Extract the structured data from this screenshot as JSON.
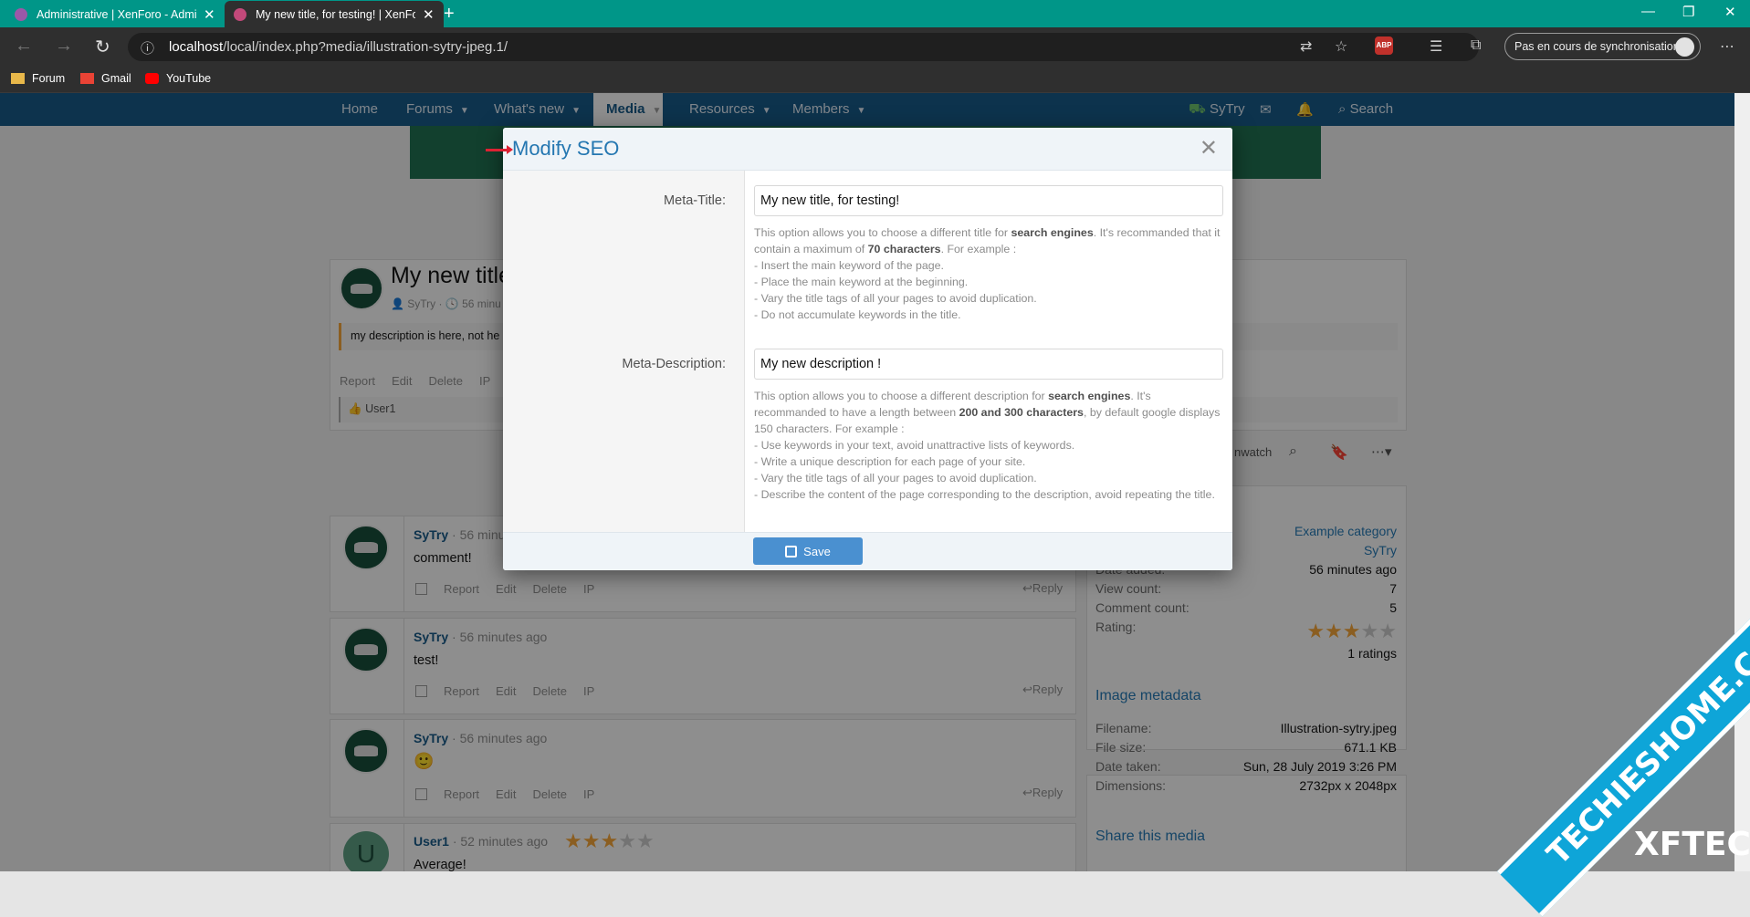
{
  "browser": {
    "tabs": [
      {
        "title": "Administrative | XenForo - Admin",
        "active": false
      },
      {
        "title": "My new title, for testing! | XenForo",
        "active": true
      }
    ],
    "url_host": "localhost",
    "url_path": "/local/index.php?media/illustration-sytry-jpeg.1/",
    "sync_label": "Pas en cours de synchronisation",
    "bookmarks": [
      "Forum",
      "Gmail",
      "YouTube"
    ]
  },
  "nav": {
    "items": [
      "Home",
      "Forums",
      "What's new",
      "Media",
      "Resources",
      "Members"
    ],
    "user": "SyTry",
    "search": "Search"
  },
  "media": {
    "title": "My new title",
    "author": "SyTry",
    "time": "56 minu",
    "description": "my description is here, not he",
    "actions": [
      "Report",
      "Edit",
      "Delete",
      "IP"
    ],
    "liker": "User1",
    "unwatch": "nwatch"
  },
  "comments": [
    {
      "user": "SyTry",
      "time": "· 56 minu",
      "text": "comment!"
    },
    {
      "user": "SyTry",
      "time": "· 56 minutes ago",
      "text": "test!"
    },
    {
      "user": "SyTry",
      "time": "· 56 minutes ago",
      "text": "🙂"
    },
    {
      "user": "User1",
      "time": "· 52 minutes ago",
      "text": "Average!"
    }
  ],
  "comment_actions": [
    "Report",
    "Edit",
    "Delete",
    "IP"
  ],
  "reply_label": "Reply",
  "sidebar": {
    "category": "Example category",
    "owner": "SyTry",
    "date_label": "Date added:",
    "date_value": "56 minutes ago",
    "view_label": "View count:",
    "view_value": "7",
    "comment_label": "Comment count:",
    "comment_value": "5",
    "rating_label": "Rating:",
    "rating_value": 3,
    "ratings_text": "1 ratings",
    "metadata_title": "Image metadata",
    "metadata": [
      {
        "k": "Filename:",
        "v": "Illustration-sytry.jpeg"
      },
      {
        "k": "File size:",
        "v": "671.1 KB"
      },
      {
        "k": "Date taken:",
        "v": "Sun, 28 July 2019 3:26 PM"
      },
      {
        "k": "Dimensions:",
        "v": "2732px x 2048px"
      }
    ],
    "share_title": "Share this media"
  },
  "modal": {
    "title": "Modify SEO",
    "meta_title_label": "Meta-Title:",
    "meta_title_value": "My new title, for testing!",
    "meta_desc_label": "Meta-Description:",
    "meta_desc_value": "My new description !",
    "save_label": "Save"
  },
  "watermark": {
    "text": "TECHIESHOME.COM",
    "text2": "XFTECH"
  },
  "colors": {
    "accent": "#185886",
    "tab_bar": "#009688",
    "save": "#4a90d0",
    "link": "#2577b1"
  }
}
